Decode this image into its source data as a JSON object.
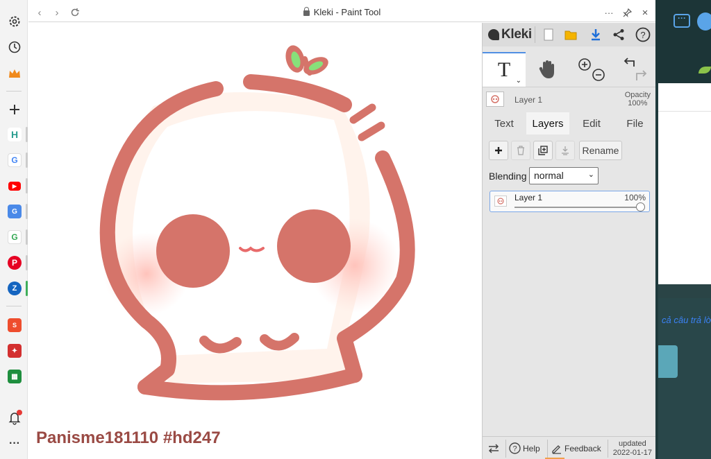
{
  "window": {
    "title": "Kleki - Paint Tool"
  },
  "canvas": {
    "watermark": "Panisme181110 #hd247"
  },
  "kleki": {
    "logo": "Kleki",
    "layer_name": "Layer 1",
    "opacity_label": "Opacity",
    "opacity_value": "100%",
    "tabs": [
      "Text",
      "Layers",
      "Edit",
      "File"
    ],
    "active_tab": "Layers",
    "rename_label": "Rename",
    "blending_label": "Blending",
    "blending_value": "normal",
    "layers": [
      {
        "name": "Layer 1",
        "opacity": "100%",
        "opacity_fraction": 1.0
      }
    ],
    "footer": {
      "help": "Help",
      "feedback": "Feedback",
      "updated_label": "updated",
      "updated_date": "2022-01-17"
    }
  },
  "background": {
    "partial_text": "cả câu trả lờ"
  },
  "colors": {
    "accent_blue": "#4f8fe3",
    "drawing_stroke": "#d5746a",
    "drawing_blush": "#ffcfc8",
    "watermark": "#9a4a44"
  }
}
